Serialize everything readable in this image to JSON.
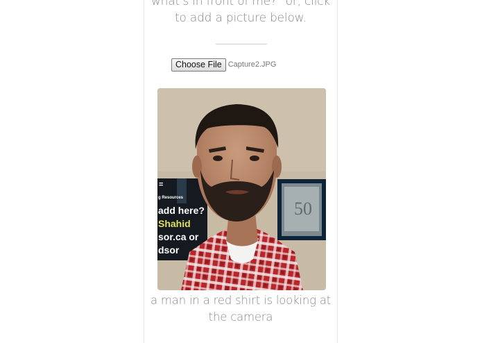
{
  "upload": {
    "instructions_text": "what's in front of me?\" or, click to add a picture below.",
    "choose_file_label": "Choose File",
    "selected_file_name": "Capture2.JPG"
  },
  "photo": {
    "poster_lines": [
      "g Resources",
      "add here?",
      "Shahid",
      "sor.ca or",
      "dsor"
    ],
    "frame_text": "50"
  },
  "result": {
    "caption": "a man in a red shirt is looking at the camera"
  },
  "colors": {
    "text_muted": "#8a8a8a",
    "card_border": "#e6e6e6",
    "shirt_red": "#b8262b",
    "wall_beige": "#c8bba6"
  }
}
